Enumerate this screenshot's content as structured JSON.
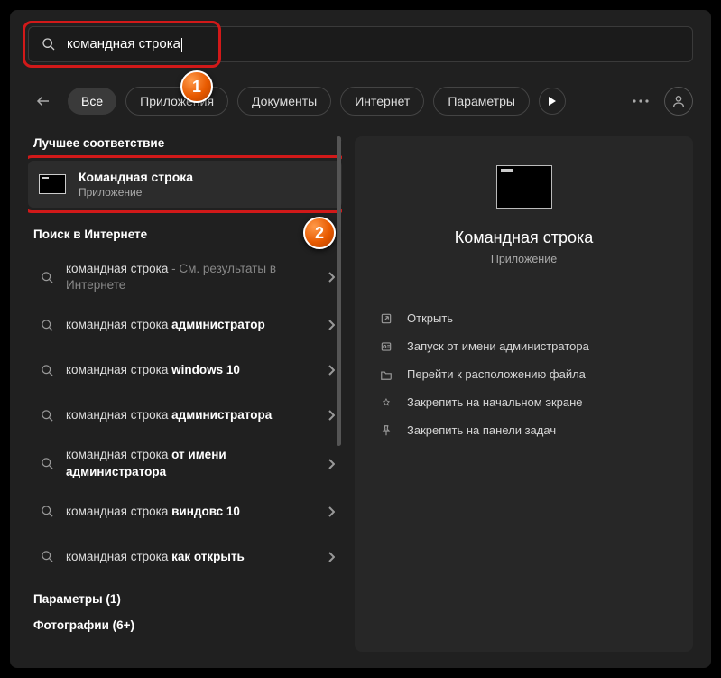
{
  "search": {
    "query": "командная строка"
  },
  "tabs": {
    "all": "Все",
    "apps": "Приложения",
    "docs": "Документы",
    "web": "Интернет",
    "params": "Параметры"
  },
  "left": {
    "best_header": "Лучшее соответствие",
    "best": {
      "name": "Командная строка",
      "sub": "Приложение"
    },
    "web_header": "Поиск в Интернете",
    "web_items": [
      {
        "prefix": "командная строка",
        "suffix_muted": " - См. результаты в Интернете",
        "bold": ""
      },
      {
        "prefix": "командная строка ",
        "bold": "администратор"
      },
      {
        "prefix": "командная строка ",
        "bold": "windows 10"
      },
      {
        "prefix": "командная строка ",
        "bold": "администратора"
      },
      {
        "prefix": "командная строка ",
        "bold": "от имени администратора"
      },
      {
        "prefix": "командная строка ",
        "bold": "виндовс 10"
      },
      {
        "prefix": "командная строка ",
        "bold": "как открыть"
      }
    ],
    "params_header": "Параметры (1)",
    "photos_header": "Фотографии (6+)"
  },
  "right": {
    "title": "Командная строка",
    "sub": "Приложение",
    "actions": [
      "Открыть",
      "Запуск от имени администратора",
      "Перейти к расположению файла",
      "Закрепить на начальном экране",
      "Закрепить на панели задач"
    ]
  },
  "callouts": {
    "one": "1",
    "two": "2"
  }
}
